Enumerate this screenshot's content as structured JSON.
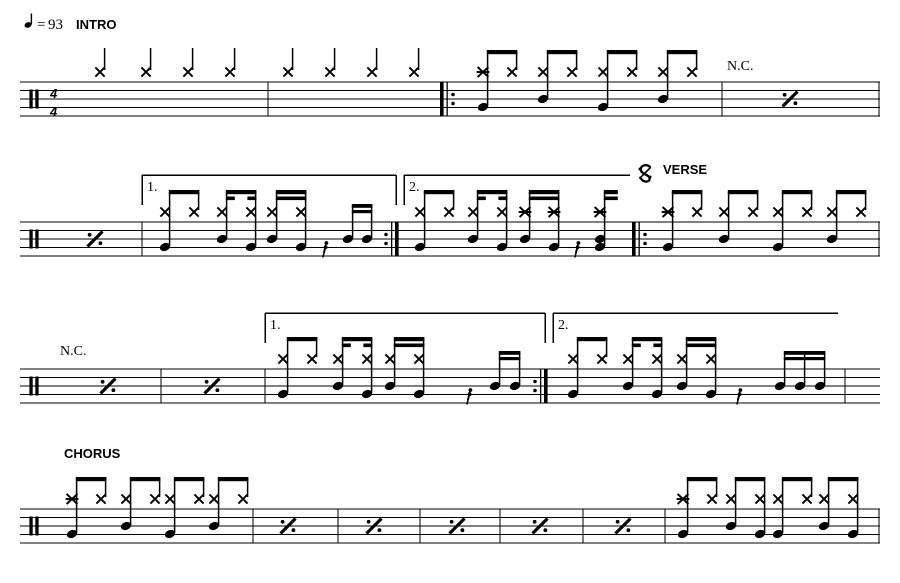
{
  "document": {
    "type": "drum-sheet-music",
    "page_background": "#ffffff",
    "ink_color": "#000000",
    "time_signature": "4/4",
    "clef": "percussion"
  },
  "tempo": {
    "note_glyph": "♩",
    "equals": "=",
    "bpm": "93",
    "full": "♩ = 93"
  },
  "sections": {
    "intro": "INTRO",
    "verse": "VERSE",
    "chorus": "CHORUS"
  },
  "chord_symbols": {
    "nc_1": "N.C.",
    "nc_2": "N.C."
  },
  "endings": {
    "first_a": "1.",
    "second_a": "2.",
    "first_b": "1.",
    "second_b": "2."
  },
  "symbols": {
    "segno": "segno-sign",
    "measure_repeat": "measure-repeat-sign",
    "repeat_start": "repeat-start-barline",
    "repeat_end": "repeat-end-barline",
    "sixteenth_rest": "sixteenth-rest",
    "cross_notehead": "cross-notehead",
    "accented_cross_notehead": "accented-cross-notehead",
    "oval_notehead": "oval-notehead"
  },
  "time_sig": {
    "top": "4",
    "bottom": "4"
  },
  "systems": [
    {
      "index": 1,
      "label": "system-1-intro",
      "measures": [
        {
          "label": "measure-1",
          "content": "four quarter hi-hat crosses"
        },
        {
          "label": "measure-2",
          "content": "four quarter hi-hat crosses"
        },
        {
          "label": "measure-3",
          "content": "eighth-note hi-hat groove with kick and snare"
        },
        {
          "label": "measure-4",
          "content": "measure repeat"
        }
      ]
    },
    {
      "index": 2,
      "label": "system-2-first-second-endings",
      "measures": [
        {
          "label": "measure-5",
          "content": "measure repeat"
        },
        {
          "label": "measure-6",
          "content": "first ending groove with sixteenth pickup"
        },
        {
          "label": "measure-7",
          "content": "second ending groove with sixteenth pickup"
        },
        {
          "label": "measure-8",
          "content": "verse groove begins"
        }
      ]
    },
    {
      "index": 3,
      "label": "system-3-verse",
      "measures": [
        {
          "label": "measure-9",
          "content": "measure repeat"
        },
        {
          "label": "measure-10",
          "content": "measure repeat"
        },
        {
          "label": "measure-11",
          "content": "first ending groove"
        },
        {
          "label": "measure-12",
          "content": "second ending groove with tom fill"
        }
      ]
    },
    {
      "index": 4,
      "label": "system-4-chorus",
      "measures": [
        {
          "label": "measure-13",
          "content": "chorus groove"
        },
        {
          "label": "measure-14",
          "content": "measure repeat"
        },
        {
          "label": "measure-15",
          "content": "measure repeat"
        },
        {
          "label": "measure-16",
          "content": "measure repeat"
        },
        {
          "label": "measure-17",
          "content": "measure repeat"
        },
        {
          "label": "measure-18",
          "content": "measure repeat"
        },
        {
          "label": "measure-19",
          "content": "chorus groove variation"
        }
      ]
    }
  ]
}
